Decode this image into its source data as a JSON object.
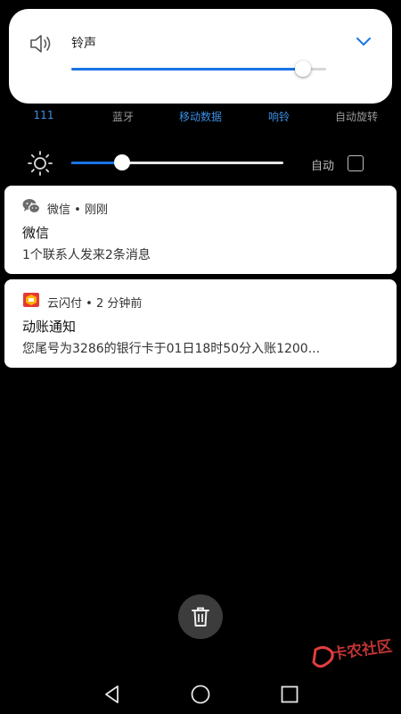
{
  "volume": {
    "label": "铃声",
    "level": 0.91,
    "accent": "#1a73e8"
  },
  "toggles": [
    {
      "label": "111",
      "active": true
    },
    {
      "label": "蓝牙",
      "active": false
    },
    {
      "label": "移动数据",
      "active": true
    },
    {
      "label": "响铃",
      "active": true
    },
    {
      "label": "自动旋转",
      "active": false
    }
  ],
  "brightness": {
    "level": 0.24,
    "auto_label": "自动",
    "auto_checked": false
  },
  "notifications": [
    {
      "app": "微信",
      "time": "刚刚",
      "title": "微信",
      "body": "1个联系人发来2条消息",
      "icon": "wechat-icon"
    },
    {
      "app": "云闪付",
      "time": "2 分钟前",
      "title": "动账通知",
      "body": "您尾号为3286的银行卡于01日18时50分入账1200...",
      "icon": "unionpay-icon"
    }
  ],
  "clear_all": {
    "icon": "trash-icon"
  },
  "navbar": {
    "icons": [
      "back-icon",
      "home-icon",
      "recents-icon"
    ]
  },
  "watermark": {
    "text": "卡农社区"
  }
}
